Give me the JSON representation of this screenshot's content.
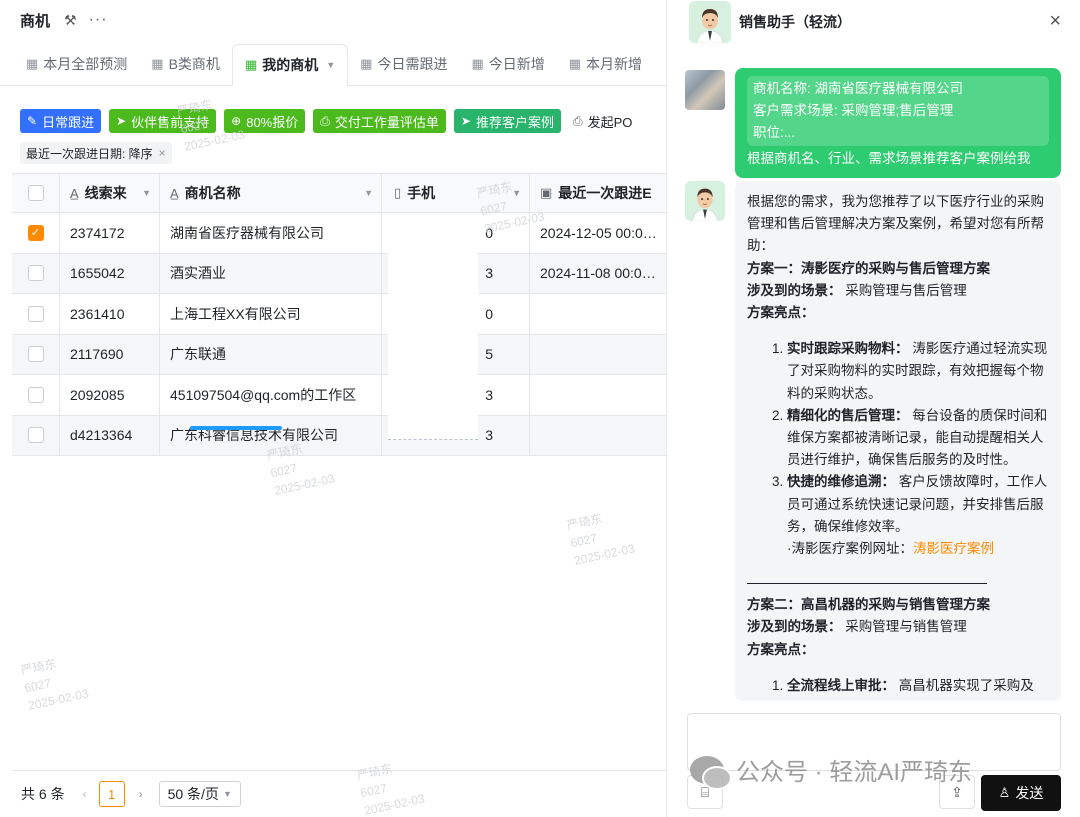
{
  "app": {
    "title": "商机",
    "tool_icon": "wrench-icon",
    "more": "···"
  },
  "tabs": [
    {
      "label": "本月全部预测",
      "icon": "table-icon",
      "active": false
    },
    {
      "label": "B类商机",
      "icon": "table-icon",
      "active": false
    },
    {
      "label": "我的商机",
      "icon": "table-icon",
      "active": true
    },
    {
      "label": "今日需跟进",
      "icon": "table-icon",
      "active": false
    },
    {
      "label": "今日新增",
      "icon": "table-icon",
      "active": false
    },
    {
      "label": "本月新增",
      "icon": "table-icon",
      "active": false
    }
  ],
  "toolbar": [
    {
      "label": "日常跟进",
      "icon": "pen-icon",
      "color": "#3370ff"
    },
    {
      "label": "伙伴售前支持",
      "icon": "send-icon",
      "color": "#4cb91c"
    },
    {
      "label": "80%报价",
      "icon": "plus-circle-icon",
      "color": "#4cb91c"
    },
    {
      "label": "交付工作量评估单",
      "icon": "printer-icon",
      "color": "#4cb91c"
    },
    {
      "label": "推荐客户案例",
      "icon": "send-icon",
      "color": "#28b46a"
    },
    {
      "label": "发起PO",
      "icon": "printer-icon",
      "color": "transparent"
    }
  ],
  "filter": {
    "label": "最近一次跟进日期: 降序",
    "close": "×"
  },
  "grid": {
    "headers": [
      "线索来",
      "商机名称",
      "手机",
      "最近一次跟进E"
    ],
    "rows": [
      {
        "checked": true,
        "id": "2374172",
        "name": "湖南省医疗器械有限公司",
        "phone_tail": "0",
        "date": "2024-12-05 00:0…"
      },
      {
        "checked": false,
        "id": "1655042",
        "name": "酒实酒业",
        "phone_tail": "3",
        "date": "2024-11-08 00:0…"
      },
      {
        "checked": false,
        "id": "2361410",
        "name": "上海工程XX有限公司",
        "phone_tail": "0",
        "date": ""
      },
      {
        "checked": false,
        "id": "2117690",
        "name": "广东联通",
        "phone_tail": "5",
        "date": ""
      },
      {
        "checked": false,
        "id": "2092085",
        "name": "451097504@qq.com的工作区",
        "phone_tail": "3",
        "date": ""
      },
      {
        "checked": false,
        "id": "d4213364",
        "name": "广东科睿信息技术有限公司",
        "phone_tail": "3",
        "date": ""
      }
    ]
  },
  "pager": {
    "total": "共 6 条",
    "prev": "‹",
    "page": "1",
    "next": "›",
    "size": "50 条/页"
  },
  "watermark": {
    "name": "严琦东",
    "code": "6027",
    "date": "2025-02-03"
  },
  "panel": {
    "title": "销售助手（轻流）",
    "close": "×",
    "user_message": {
      "quote_lines": [
        "商机名称: 湖南省医疗器械有限公司",
        "客户需求场景: 采购管理;售后管理",
        "职位:..."
      ],
      "text": "根据商机名、行业、需求场景推荐客户案例给我"
    },
    "bot_message": {
      "intro": "根据您的需求，我为您推荐了以下医疗行业的采购管理和售后管理解决方案及案例，希望对您有所帮助：",
      "plan1_title": "方案一：涛影医疗的采购与售后管理方案",
      "plan1_scene_label": "涉及到的场景：",
      "plan1_scene": "采购管理与售后管理",
      "plan1_highlights": "方案亮点：",
      "plan1_items": [
        {
          "title": "实时跟踪采购物料：",
          "text": "涛影医疗通过轻流实现了对采购物料的实时跟踪，有效把握每个物料的采购状态。"
        },
        {
          "title": "精细化的售后管理：",
          "text": "每台设备的质保时间和维保方案都被清晰记录，能自动提醒相关人员进行维护，确保售后服务的及时性。"
        },
        {
          "title": "快捷的维修追溯：",
          "text": "客户反馈故障时，工作人员可通过系统快速记录问题，并安排售后服务，确保维修效率。"
        }
      ],
      "plan1_link_label": "·涛影医疗案例网址：",
      "plan1_link": "涛影医疗案例",
      "plan2_title": "方案二：高昌机器的采购与销售管理方案",
      "plan2_scene_label": "涉及到的场景：",
      "plan2_scene": "采购管理与销售管理",
      "plan2_highlights": "方案亮点：",
      "plan2_items": [
        {
          "title": "全流程线上审批：",
          "text": "高昌机器实现了采购及"
        }
      ]
    },
    "send_label": "发送",
    "attach_icon": "broom-icon",
    "upload_icon": "upload-icon"
  },
  "overlay": {
    "wechat_text": "公众号 · 轻流AI严琦东"
  }
}
